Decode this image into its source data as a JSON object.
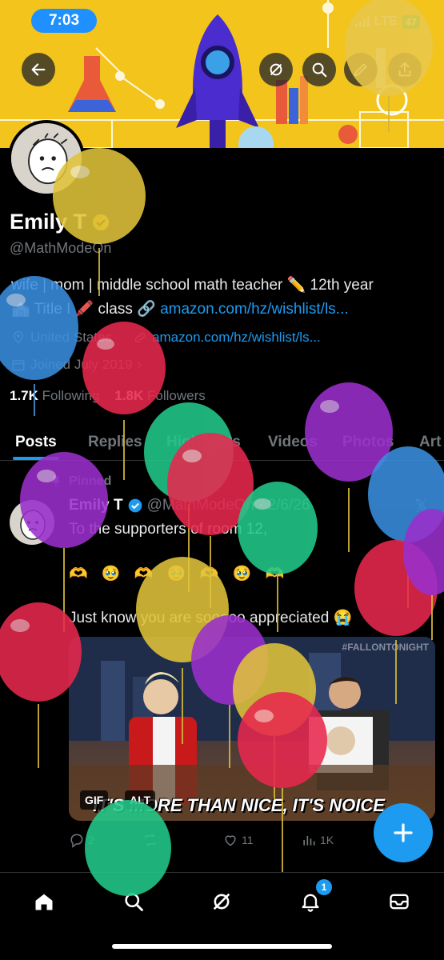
{
  "status_bar": {
    "time": "7:03",
    "network": "LTE",
    "battery": "47"
  },
  "header": {
    "back_icon": "arrow-left-icon",
    "grok_icon": "grok-icon",
    "search_icon": "search-icon",
    "edit_icon": "pencil-icon",
    "share_icon": "share-icon"
  },
  "profile": {
    "name": "Emily T",
    "handle": "@MathModeOn",
    "bio_line1": "wife | mom | middle school math teacher ✏️ 12th year",
    "bio_line2_prefix": "🏫 Title I 🖍️ class 🔗 ",
    "bio_link": "amazon.com/hz/wishlist/ls...",
    "location": "United States",
    "website": "amazon.com/hz/wishlist/ls...",
    "joined": "Joined July 2019",
    "following_count": "1.7K",
    "following_label": "Following",
    "followers_count": "1.8K",
    "followers_label": "Followers"
  },
  "tabs": [
    "Posts",
    "Replies",
    "Highlights",
    "Videos",
    "Photos",
    "Art"
  ],
  "post": {
    "pinned_label": "Pinned",
    "author": "Emily T",
    "handle": "@MathModeOn",
    "date": "· 2/6/26",
    "line1": "To the supporters of room 12,",
    "line2": "🫶 🥹 🫶 🥹 🫶 🥹 🫶",
    "line3": "Just know you are sooooo appreciated 😭",
    "media_watermark": "#FALLONTONIGHT",
    "media_caption": "IT'S MORE THAN NICE, IT'S NOICE",
    "gif_badge": "GIF",
    "alt_badge": "ALT",
    "replies": "2",
    "reposts": "",
    "likes": "11",
    "views": "1K"
  },
  "bottom_nav": {
    "notifications_badge": "1"
  },
  "colors": {
    "accent": "#1d9bf0",
    "banner": "#f2c41c",
    "background": "#000000"
  }
}
